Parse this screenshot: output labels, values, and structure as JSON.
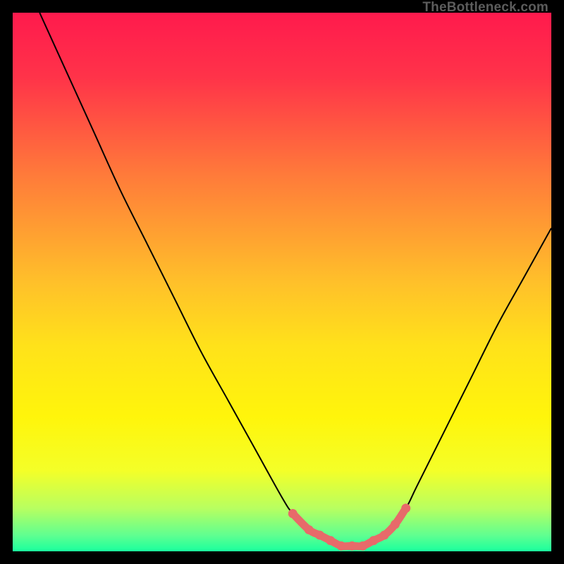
{
  "watermark": "TheBottleneck.com",
  "chart_data": {
    "type": "line",
    "title": "",
    "xlabel": "",
    "ylabel": "",
    "xlim": [
      0,
      100
    ],
    "ylim": [
      0,
      100
    ],
    "grid": false,
    "legend": false,
    "series": [
      {
        "name": "bottleneck-curve",
        "color": "#000000",
        "x": [
          5,
          10,
          15,
          20,
          25,
          30,
          35,
          40,
          45,
          50,
          52,
          55,
          58,
          60,
          62,
          65,
          68,
          70,
          73,
          75,
          80,
          85,
          90,
          95,
          100
        ],
        "y": [
          100,
          89,
          78,
          67,
          57,
          47,
          37,
          28,
          19,
          10,
          7,
          4,
          2,
          1,
          1,
          1,
          2,
          4,
          8,
          12,
          22,
          32,
          42,
          51,
          60
        ]
      },
      {
        "name": "optimal-zone-markers",
        "type": "scatter",
        "color": "#e76a6a",
        "x": [
          52,
          55,
          57,
          59,
          61,
          63,
          65,
          67,
          69,
          71,
          73
        ],
        "y": [
          7,
          4,
          3,
          2,
          1,
          1,
          1,
          2,
          3,
          5,
          8
        ]
      }
    ],
    "background_gradient": {
      "stops": [
        {
          "offset": 0.0,
          "color": "#ff1a4d"
        },
        {
          "offset": 0.12,
          "color": "#ff3349"
        },
        {
          "offset": 0.3,
          "color": "#ff7a3a"
        },
        {
          "offset": 0.5,
          "color": "#ffc02a"
        },
        {
          "offset": 0.62,
          "color": "#ffe21a"
        },
        {
          "offset": 0.75,
          "color": "#fff50b"
        },
        {
          "offset": 0.85,
          "color": "#f4ff28"
        },
        {
          "offset": 0.92,
          "color": "#b8ff60"
        },
        {
          "offset": 0.97,
          "color": "#60ff90"
        },
        {
          "offset": 1.0,
          "color": "#1aff9e"
        }
      ]
    }
  }
}
